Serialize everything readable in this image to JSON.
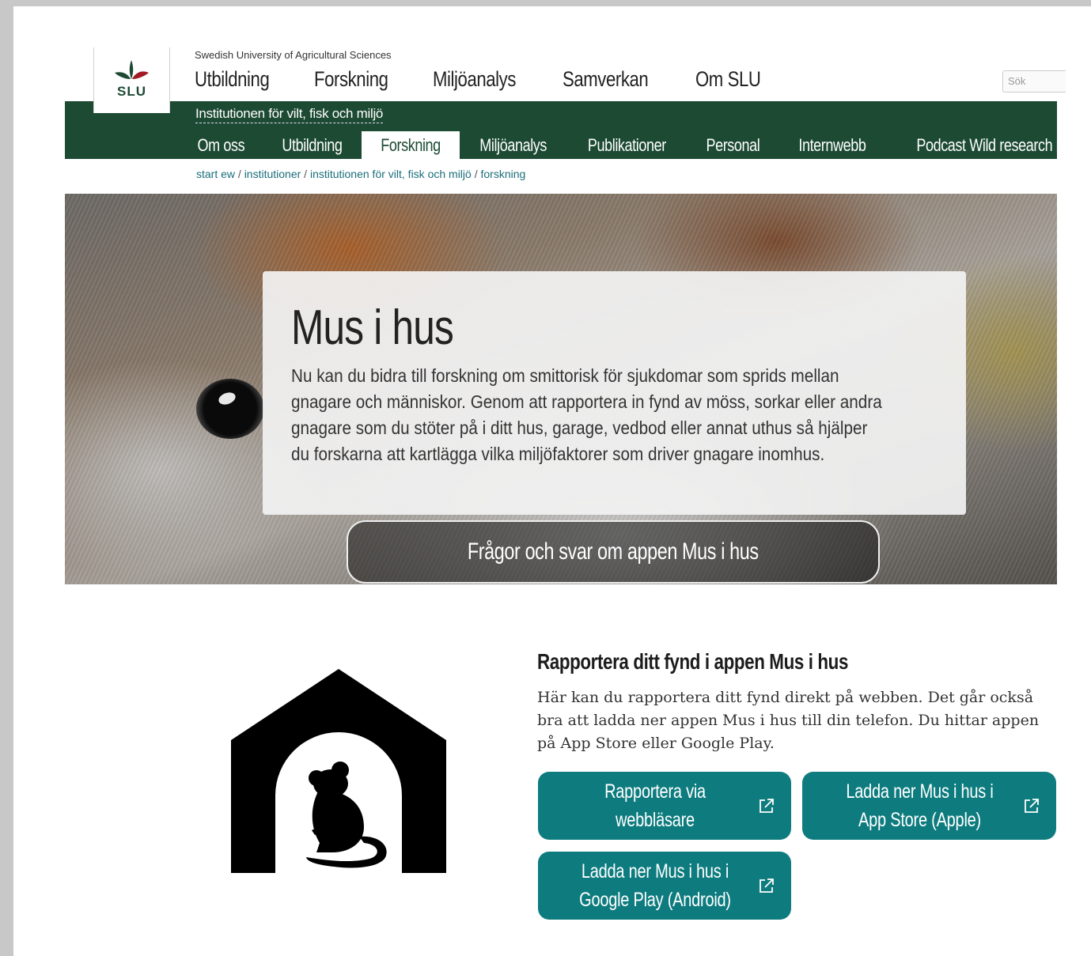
{
  "header": {
    "logo_text": "SLU",
    "university": "Swedish University of Agricultural Sciences",
    "main_nav": [
      "Utbildning",
      "Forskning",
      "Miljöanalys",
      "Samverkan",
      "Om SLU"
    ],
    "search_placeholder": "Sök"
  },
  "department": "Institutionen för vilt, fisk och miljö",
  "sub_nav": [
    {
      "label": "Om oss",
      "active": false
    },
    {
      "label": "Utbildning",
      "active": false
    },
    {
      "label": "Forskning",
      "active": true
    },
    {
      "label": "Miljöanalys",
      "active": false
    },
    {
      "label": "Publikationer",
      "active": false
    },
    {
      "label": "Personal",
      "active": false
    },
    {
      "label": "Internwebb",
      "active": false
    },
    {
      "label": "Podcast Wild research bites",
      "active": false
    }
  ],
  "breadcrumb": {
    "items": [
      "start ew",
      "institutioner",
      "institutionen för vilt, fisk och miljö",
      "forskning"
    ],
    "separator": " / "
  },
  "hero": {
    "title": "Mus i hus",
    "text": "Nu kan du bidra till forskning om smittorisk för sjukdomar som sprids mellan gnagare och människor. Genom att rapportera in fynd av möss, sorkar eller andra gnagare som du stöter på i ditt hus, garage, vedbod eller annat uthus så hjälper du forskarna att kartlägga vilka miljöfaktorer som driver gnagare inomhus.",
    "faq_button": "Frågor och svar om appen Mus i hus"
  },
  "report": {
    "title": "Rapportera ditt fynd i appen Mus i hus",
    "text": "Här kan du rapportera ditt fynd direkt på webben. Det går också bra att ladda ner appen Mus i hus till din telefon. Du hittar appen på App Store eller Google Play.",
    "buttons": {
      "web": "Rapportera via webbläsare",
      "appstore": "Ladda ner Mus i hus i App Store (Apple)",
      "googleplay": "Ladda ner Mus i hus i Google Play (Android)"
    }
  },
  "colors": {
    "green_bar": "#1c4a33",
    "teal_button": "#0e7c7f",
    "link": "#1b6e7a"
  }
}
